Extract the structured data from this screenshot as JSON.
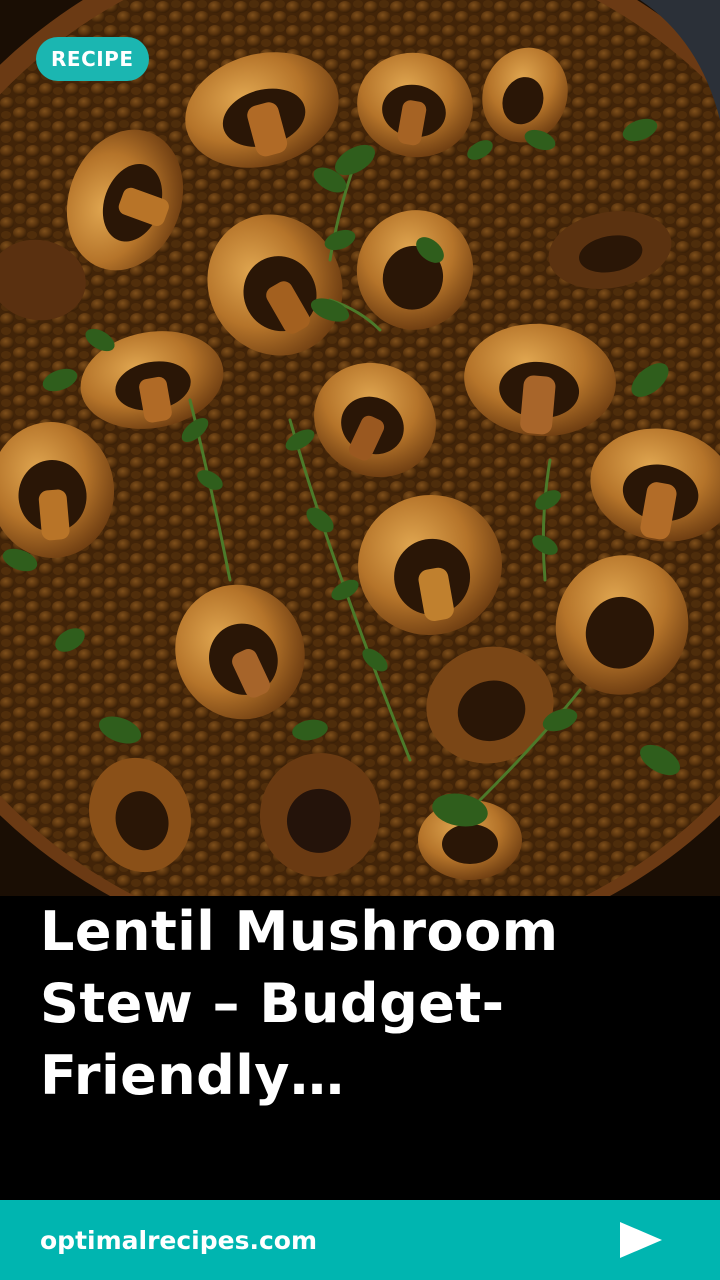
{
  "hero": {
    "image_icon": "lentil-mushroom-stew-photo"
  },
  "badge": {
    "label": "RECIPE",
    "color": "#1bb6b1"
  },
  "story": {
    "title": "Lentil Mushroom Stew – Budget-Friendly…"
  },
  "footer": {
    "site": "optimalrecipes.com",
    "next_icon": "play-arrow-icon",
    "color": "#00b5b0"
  }
}
